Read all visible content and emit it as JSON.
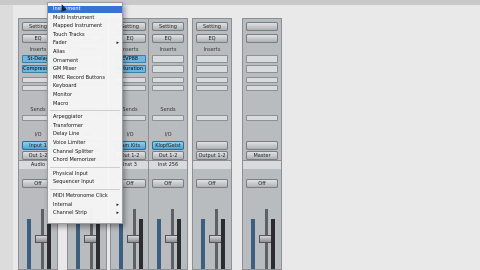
{
  "strips": [
    {
      "setting": "Setting",
      "eq": "EQ",
      "inserts": "Inserts",
      "insert1": "St-Delay",
      "insert2": "Compressor",
      "sends": "Sends",
      "io": "I/O",
      "input": "Input 1",
      "output": "Out 1-2",
      "name": "Audio",
      "off": "Off"
    },
    {
      "setting": "Setting",
      "eq": "EQ",
      "inserts": "Inserts",
      "insert1": "",
      "insert2": "",
      "sends": "Sends",
      "io": "I/O",
      "input": "",
      "output": "",
      "name": "",
      "off": "Off"
    },
    {
      "setting": "Setting",
      "eq": "EQ",
      "inserts": "Inserts",
      "insert1": "EVP88",
      "insert2": "Saturation",
      "sends": "Sends",
      "io": "I/O",
      "input": "Jam Kits",
      "output": "Out 1-2",
      "name": "Inst 3",
      "off": "Off"
    },
    {
      "setting": "Setting",
      "eq": "EQ",
      "inserts": "Inserts",
      "insert1": "",
      "insert2": "",
      "sends": "Sends",
      "io": "I/O",
      "input": "KlopfGeist",
      "output": "Out 1-2",
      "name": "Inst 256",
      "off": "Off"
    },
    {
      "setting": "Setting",
      "eq": "EQ",
      "inserts": "Inserts",
      "insert1": "",
      "insert2": "",
      "sends": "",
      "io": "",
      "input": "",
      "output": "Output 1-2",
      "name": "",
      "off": "Off"
    },
    {
      "setting": "",
      "eq": "",
      "inserts": "",
      "insert1": "",
      "insert2": "",
      "sends": "",
      "io": "",
      "input": "",
      "output": "Master",
      "name": "",
      "off": "Off"
    }
  ],
  "menu": {
    "items": [
      {
        "label": "Instrument",
        "selected": true,
        "submenu": false
      },
      {
        "label": "Multi Instrument",
        "selected": false,
        "submenu": false
      },
      {
        "label": "Mapped Instrument",
        "selected": false,
        "submenu": false
      },
      {
        "label": "Touch Tracks",
        "selected": false,
        "submenu": false
      },
      {
        "label": "Fader",
        "selected": false,
        "submenu": true
      },
      {
        "label": "Alias",
        "selected": false,
        "submenu": false
      },
      {
        "label": "Ornament",
        "selected": false,
        "submenu": false
      },
      {
        "label": "GM Mixer",
        "selected": false,
        "submenu": false
      },
      {
        "label": "MMC Record Buttons",
        "selected": false,
        "submenu": false
      },
      {
        "label": "Keyboard",
        "selected": false,
        "submenu": false
      },
      {
        "label": "Monitor",
        "selected": false,
        "submenu": false
      },
      {
        "label": "Macro",
        "selected": false,
        "submenu": false
      },
      {
        "label": "Arpeggiator",
        "selected": false,
        "submenu": false
      },
      {
        "label": "Transformer",
        "selected": false,
        "submenu": false
      },
      {
        "label": "Delay Line",
        "selected": false,
        "submenu": false
      },
      {
        "label": "Voice Limiter",
        "selected": false,
        "submenu": false
      },
      {
        "label": "Channel Splitter",
        "selected": false,
        "submenu": false
      },
      {
        "label": "Chord Memorizer",
        "selected": false,
        "submenu": false
      },
      {
        "label": "Physical Input",
        "selected": false,
        "submenu": false
      },
      {
        "label": "Sequencer Input",
        "selected": false,
        "submenu": false
      },
      {
        "label": "MIDI Metronome Click",
        "selected": false,
        "submenu": false
      },
      {
        "label": "Internal",
        "selected": false,
        "submenu": true
      },
      {
        "label": "Channel Strip",
        "selected": false,
        "submenu": true
      }
    ],
    "submenu_glyph": "▸"
  },
  "icons": {
    "pointer": "arrow-cursor-icon"
  },
  "colors": {
    "accent": "#3a72d4",
    "insert_blue": "#6fb6e0"
  }
}
